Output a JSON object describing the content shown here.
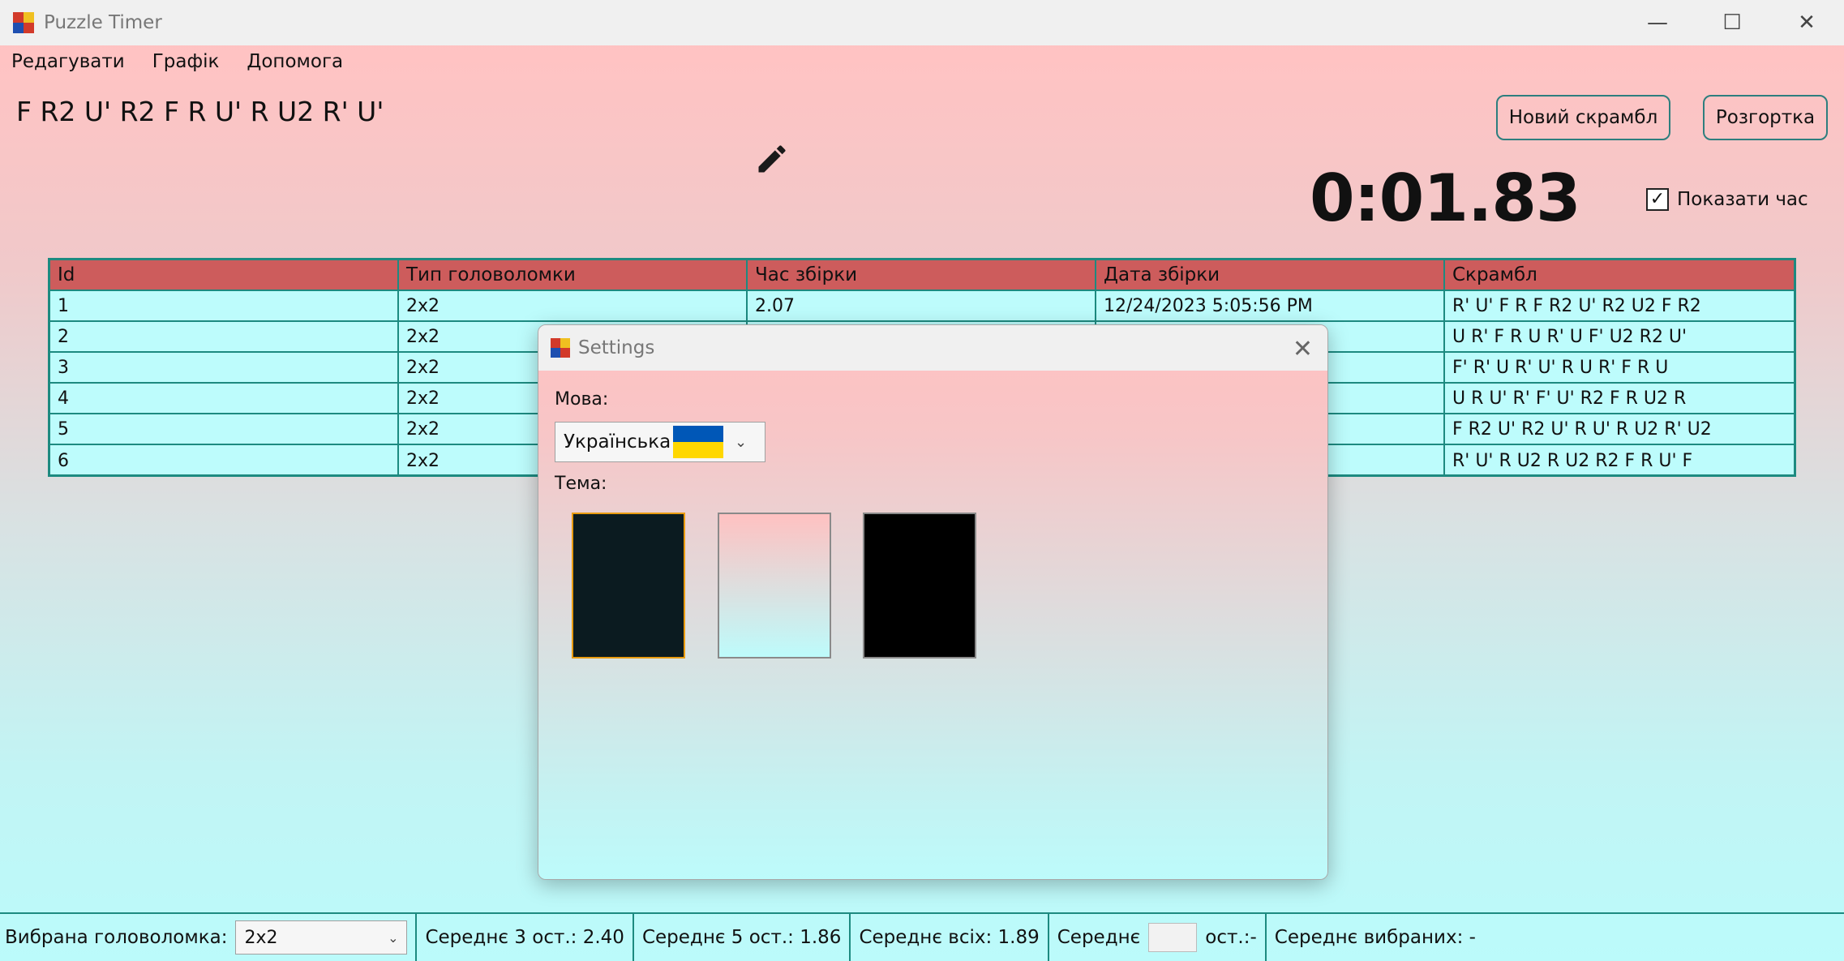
{
  "window": {
    "title": "Puzzle Timer",
    "minimize_glyph": "—",
    "maximize_glyph": "☐",
    "close_glyph": "✕"
  },
  "menu": [
    "Редагувати",
    "Графік",
    "Допомога"
  ],
  "scramble": "F R2 U' R2 F R U' R U2 R' U'",
  "buttons": {
    "new_scramble": "Новий скрамбл",
    "net": "Розгортка"
  },
  "timer": "0:01.83",
  "show_time": {
    "label": "Показати час",
    "checked": true,
    "check_glyph": "✓"
  },
  "table": {
    "headers": [
      "Id",
      "Тип головоломки",
      "Час збірки",
      "Дата збірки",
      "Скрамбл"
    ],
    "rows": [
      [
        "1",
        "2x2",
        "2.07",
        "12/24/2023 5:05:56 PM",
        "R' U' F R F R2 U' R2 U2 F R2"
      ],
      [
        "2",
        "2x2",
        "",
        "",
        "U R' F R U R' U F' U2 R2 U'"
      ],
      [
        "3",
        "2x2",
        "",
        "",
        "F' R' U R' U' R U R' F R U"
      ],
      [
        "4",
        "2x2",
        "",
        "",
        "U R U' R' F' U' R2 F R U2 R"
      ],
      [
        "5",
        "2x2",
        "",
        "",
        "F R2 U' R2 U' R U' R U2 R' U2"
      ],
      [
        "6",
        "2x2",
        "",
        "",
        "R' U' R U2 R U2 R2 F R U' F"
      ]
    ]
  },
  "settings": {
    "title": "Settings",
    "close_glyph": "✕",
    "language_label": "Мова:",
    "language_value": "Українська",
    "language_flag_colors": [
      "#0057b7",
      "#ffd700"
    ],
    "theme_label": "Тема:",
    "themes": [
      {
        "name": "dark",
        "color": "#0b1b20",
        "selected": true
      },
      {
        "name": "gradient",
        "color_top": "#ffc1c1",
        "color_bottom": "#bdfbfb",
        "selected": false
      },
      {
        "name": "black",
        "color": "#000000",
        "selected": false
      }
    ]
  },
  "status": {
    "puzzle_label": "Вибрана головоломка:",
    "puzzle_value": "2x2",
    "avg3": "Середнє 3 ост.: 2.40",
    "avg5": "Середнє 5 ост.: 1.86",
    "avg_all": "Середнє всіх: 1.89",
    "avg_custom_prefix": "Середнє",
    "avg_custom_suffix": "ост.:-",
    "avg_selected": "Середнє вибраних: -"
  },
  "colors": {
    "accent": "#1d8a80",
    "table_header": "#cd5c5c",
    "table_body": "#bdfcfc"
  }
}
